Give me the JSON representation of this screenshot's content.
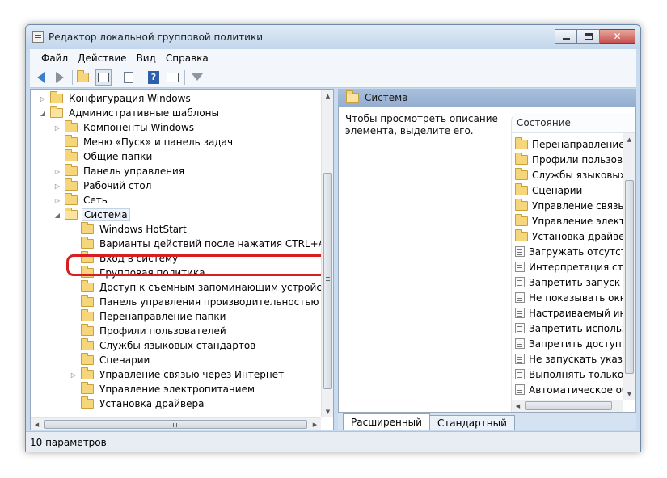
{
  "window": {
    "title": "Редактор локальной групповой политики"
  },
  "menu": [
    "Файл",
    "Действие",
    "Вид",
    "Справка"
  ],
  "toolbar": {
    "help_glyph": "?"
  },
  "tree": {
    "items": [
      {
        "label": "Конфигурация Windows",
        "expander": "▷"
      },
      {
        "label": "Административные шаблоны",
        "expander": "◢"
      },
      {
        "label": "Компоненты Windows",
        "expander": "▷"
      },
      {
        "label": "Меню «Пуск» и панель задач",
        "expander": ""
      },
      {
        "label": "Общие папки",
        "expander": ""
      },
      {
        "label": "Панель управления",
        "expander": "▷"
      },
      {
        "label": "Рабочий стол",
        "expander": "▷"
      },
      {
        "label": "Сеть",
        "expander": "▷"
      },
      {
        "label": "Система",
        "expander": "◢"
      },
      {
        "label": "Windows HotStart",
        "expander": ""
      },
      {
        "label": "Варианты действий после нажатия CTRL+ALT+DEL",
        "expander": ""
      },
      {
        "label": "Вход в систему",
        "expander": ""
      },
      {
        "label": "Групповая политика",
        "expander": ""
      },
      {
        "label": "Доступ к съемным запоминающим устройствам",
        "expander": ""
      },
      {
        "label": "Панель управления производительностью",
        "expander": ""
      },
      {
        "label": "Перенаправление папки",
        "expander": ""
      },
      {
        "label": "Профили пользователей",
        "expander": ""
      },
      {
        "label": "Службы языковых стандартов",
        "expander": ""
      },
      {
        "label": "Сценарии",
        "expander": ""
      },
      {
        "label": "Управление связью через Интернет",
        "expander": "▷"
      },
      {
        "label": "Управление электропитанием",
        "expander": ""
      },
      {
        "label": "Установка драйвера",
        "expander": ""
      }
    ]
  },
  "right": {
    "header": "Система",
    "description": "Чтобы просмотреть описание элемента, выделите его.",
    "column": "Состояние",
    "rows": [
      {
        "label": "Перенаправление папк",
        "kind": "folder"
      },
      {
        "label": "Профили пользовате",
        "kind": "folder"
      },
      {
        "label": "Службы языковых ст",
        "kind": "folder"
      },
      {
        "label": "Сценарии",
        "kind": "folder"
      },
      {
        "label": "Управление связью ч",
        "kind": "folder"
      },
      {
        "label": "Управление электро",
        "kind": "folder"
      },
      {
        "label": "Установка драйвера",
        "kind": "folder"
      },
      {
        "label": "Загружать отсутству",
        "kind": "policy"
      },
      {
        "label": "Интерпретация столе",
        "kind": "policy"
      },
      {
        "label": "Запретить запуск из с",
        "kind": "policy"
      },
      {
        "label": "Не показывать окно п",
        "kind": "policy"
      },
      {
        "label": "Настраиваемый инте",
        "kind": "policy"
      },
      {
        "label": "Запретить использов",
        "kind": "policy"
      },
      {
        "label": "Запретить доступ к ср",
        "kind": "policy"
      },
      {
        "label": "Не запускать указанн",
        "kind": "policy"
      },
      {
        "label": "Выполнять только ук",
        "kind": "policy"
      },
      {
        "label": "Автоматическое обн",
        "kind": "policy"
      }
    ],
    "tabs": [
      "Расширенный",
      "Стандартный"
    ]
  },
  "status": "10 параметров"
}
